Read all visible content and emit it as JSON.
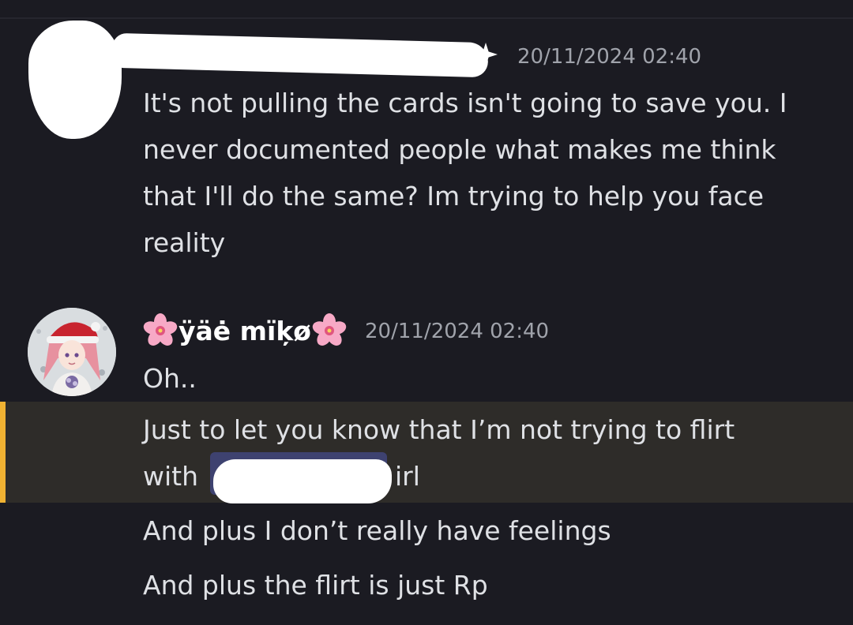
{
  "messages": [
    {
      "author": "",
      "timestamp": "20/11/2024 02:40",
      "lines": [
        "It's not pulling the cards isn't going to save you. I",
        "never documented people what makes me think",
        "that I'll do the same? Im trying to help you face",
        "reality"
      ]
    },
    {
      "author": "ÿäė mïķø",
      "timestamp": "20/11/2024 02:40",
      "lines": [
        "Oh..",
        "Just to let you know that I’m not trying to flirt",
        "with",
        "irl",
        "And plus I don’t really have feelings",
        "And plus the flirt is just Rp"
      ],
      "highlight_color": "#f0b232"
    }
  ],
  "icons": {
    "author_decoration": "cherry-blossom-icon"
  },
  "colors": {
    "background": "#1b1b22",
    "text": "#dfe1e5",
    "timestamp": "#a0a3ab",
    "mention_highlight_bg": "#2e2c29",
    "mention_pill": "#3e4270"
  }
}
